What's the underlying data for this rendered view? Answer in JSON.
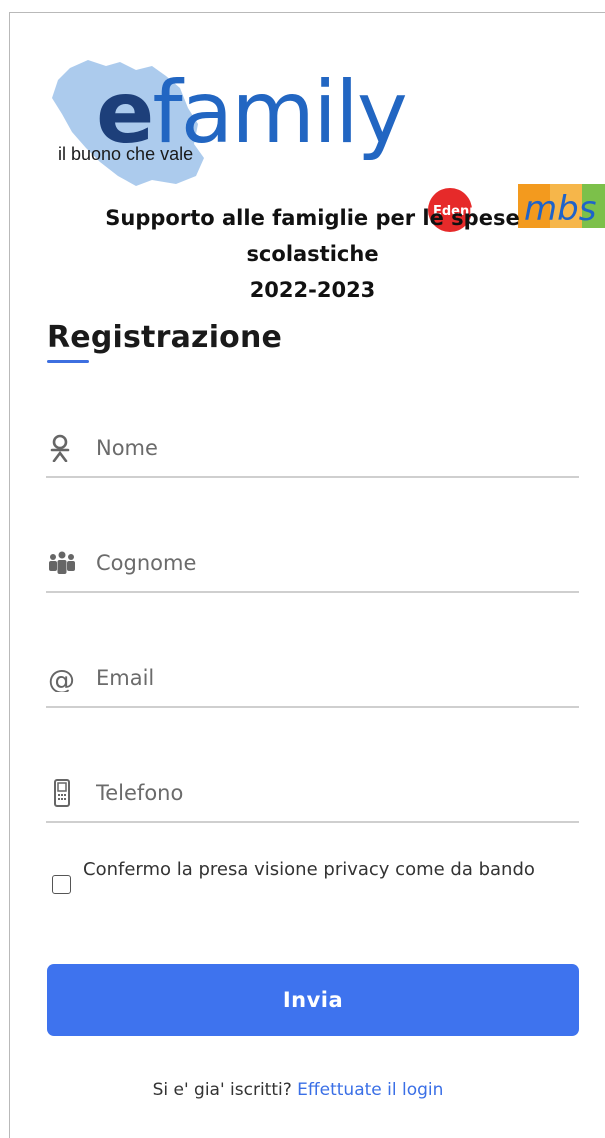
{
  "logo": {
    "word_e": "e",
    "word_rest": "family",
    "tagline": "il buono che vale",
    "partner_1": "Edenred",
    "partner_2": "mbs"
  },
  "heading": {
    "line1": "Supporto alle famiglie per le spese",
    "line2": "scolastiche",
    "line3": "2022-2023"
  },
  "form": {
    "title": "Registrazione",
    "fields": [
      {
        "placeholder": "Nome",
        "icon": "user-icon"
      },
      {
        "placeholder": "Cognome",
        "icon": "group-icon"
      },
      {
        "placeholder": "Email",
        "icon": "at-icon"
      },
      {
        "placeholder": "Telefono",
        "icon": "phone-icon"
      }
    ],
    "consent_label": "Confermo la presa visione privacy come da bando",
    "consent_checked": false,
    "submit_label": "Invia",
    "login_prompt": "Si e' gia' iscritti?",
    "login_link": "Effettuate il login"
  },
  "colors": {
    "accent": "#3e73ee",
    "link": "#3a6fe6",
    "logo_dark": "#1d3f7a",
    "logo_blue": "#2266c2"
  }
}
